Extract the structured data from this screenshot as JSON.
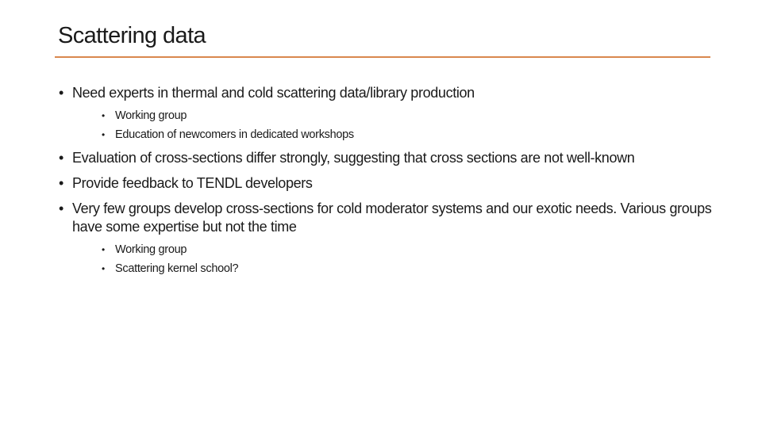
{
  "slide": {
    "title": "Scattering data",
    "accent_color": "#d9884e",
    "bullet_glyph": "•",
    "bullets": [
      {
        "text": "Need experts in thermal and cold scattering data/library production",
        "sub": [
          "Working group",
          "Education of newcomers in dedicated workshops"
        ]
      },
      {
        "text": "Evaluation of cross-sections differ strongly, suggesting that cross sections are not well-known",
        "sub": []
      },
      {
        "text": "Provide feedback to TENDL developers",
        "sub": []
      },
      {
        "text": "Very few groups develop cross-sections for cold moderator systems and our exotic needs. Various groups have some expertise but not the time",
        "sub": [
          "Working group",
          "Scattering kernel school?"
        ]
      }
    ]
  }
}
